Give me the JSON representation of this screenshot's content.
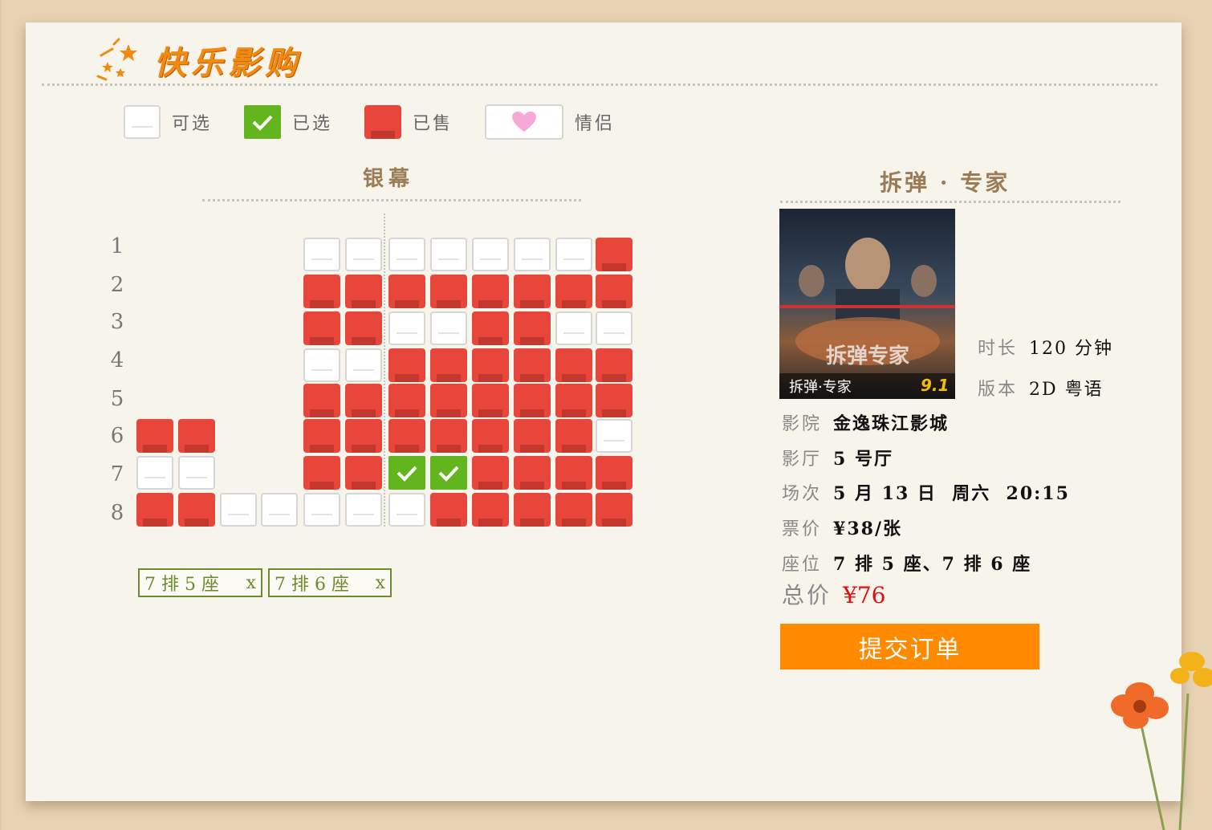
{
  "logo": {
    "text": "快乐影购"
  },
  "legend": {
    "available": "可选",
    "selected": "已选",
    "sold": "已售",
    "couple": "情侣"
  },
  "screen": {
    "label": "银幕"
  },
  "rows": [
    "1",
    "2",
    "3",
    "4",
    "5",
    "6",
    "7",
    "8"
  ],
  "selected_tickets": [
    {
      "label": "7 排 5 座",
      "remove": "x"
    },
    {
      "label": "7 排 6 座",
      "remove": "x"
    }
  ],
  "movie": {
    "title": "拆弹 · 专家",
    "poster_title": "拆弹·专家",
    "poster_rating": "9.1",
    "duration_label": "时长",
    "duration_value": "120 分钟",
    "version_label": "版本",
    "version_value": "2D 粤语"
  },
  "order": {
    "cinema_label": "影院",
    "cinema_value": "金逸珠江影城",
    "hall_label": "影厅",
    "hall_value": "5 号厅",
    "session_label": "场次",
    "session_value": "5 月 13 日  周六  20:15",
    "price_label": "票价",
    "price_value": "¥38/张",
    "seats_label": "座位",
    "seats_value": "7 排 5 座、7 排 6 座",
    "total_label": "总价",
    "total_value": "¥76",
    "submit_label": "提交订单"
  },
  "seat_map": {
    "columns": 12,
    "rows": [
      [
        "",
        "",
        "",
        "",
        "A",
        "A",
        "A",
        "A",
        "A",
        "A",
        "A",
        "S"
      ],
      [
        "",
        "",
        "",
        "",
        "S",
        "S",
        "S",
        "S",
        "S",
        "S",
        "S",
        "S"
      ],
      [
        "",
        "",
        "",
        "",
        "S",
        "S",
        "A",
        "A",
        "S",
        "S",
        "A",
        "A"
      ],
      [
        "",
        "",
        "",
        "",
        "A",
        "A",
        "S",
        "S",
        "S",
        "S",
        "S",
        "S"
      ],
      [
        "",
        "",
        "",
        "",
        "S",
        "S",
        "S",
        "S",
        "S",
        "S",
        "S",
        "S"
      ],
      [
        "S",
        "S",
        "",
        "",
        "S",
        "S",
        "S",
        "S",
        "S",
        "S",
        "S",
        "A"
      ],
      [
        "A",
        "A",
        "",
        "",
        "S",
        "S",
        "X",
        "X",
        "S",
        "S",
        "S",
        "S"
      ],
      [
        "S",
        "S",
        "A",
        "A",
        "A",
        "A",
        "A",
        "S",
        "S",
        "S",
        "S",
        "S"
      ]
    ]
  },
  "colors": {
    "sold": "#e8463b",
    "selected": "#63b51e",
    "accent": "#ff8a00",
    "heart": "#f7a8d8"
  }
}
